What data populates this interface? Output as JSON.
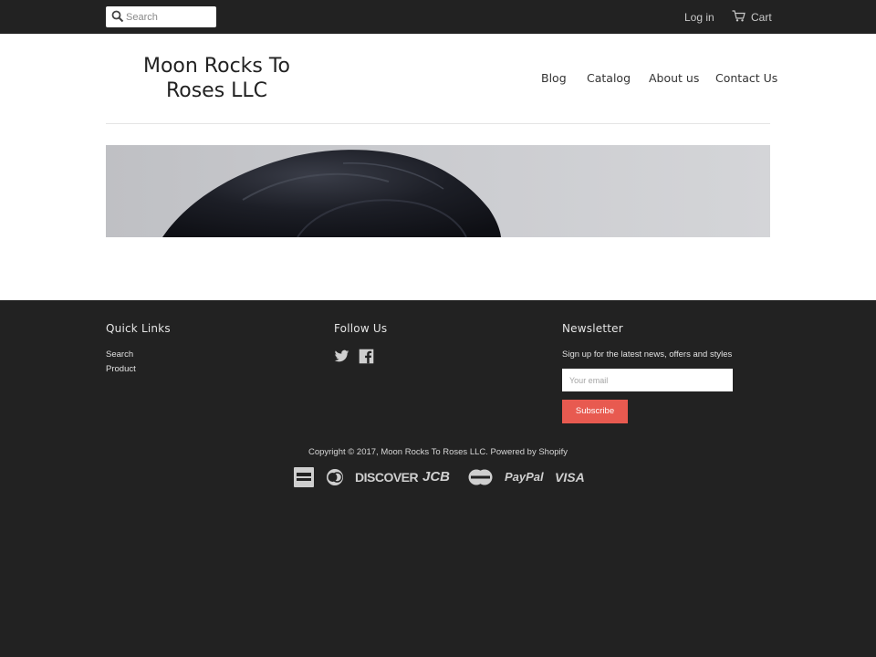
{
  "topbar": {
    "search": {
      "placeholder": "Search",
      "icon": "search-icon"
    },
    "login_label": "Log in",
    "cart_label": "Cart",
    "cart_icon": "cart-icon"
  },
  "header": {
    "logo_line1": "Moon Rocks To",
    "logo_line2": "Roses LLC",
    "nav": [
      "Blog",
      "Catalog",
      "About us",
      "Contact Us"
    ]
  },
  "hero": {
    "icon": "black-rose-photo"
  },
  "footer": {
    "quick_links": {
      "title": "Quick Links",
      "items": [
        "Search",
        "Product"
      ]
    },
    "follow_us": {
      "title": "Follow Us",
      "icons": [
        "twitter-icon",
        "facebook-icon"
      ]
    },
    "newsletter": {
      "title": "Newsletter",
      "text": "Sign up for the latest news, offers and styles",
      "email_placeholder": "Your email",
      "subscribe_label": "Subscribe"
    },
    "copyright": "Copyright © 2017, Moon Rocks To Roses LLC. Powered by Shopify",
    "payments": [
      "American Express",
      "Diners Club",
      "DISCOVER",
      "JCB",
      "MasterCard",
      "PayPal",
      "VISA"
    ]
  },
  "colors": {
    "dark_bg": "#222222",
    "accent": "#e85a50",
    "white": "#ffffff"
  }
}
